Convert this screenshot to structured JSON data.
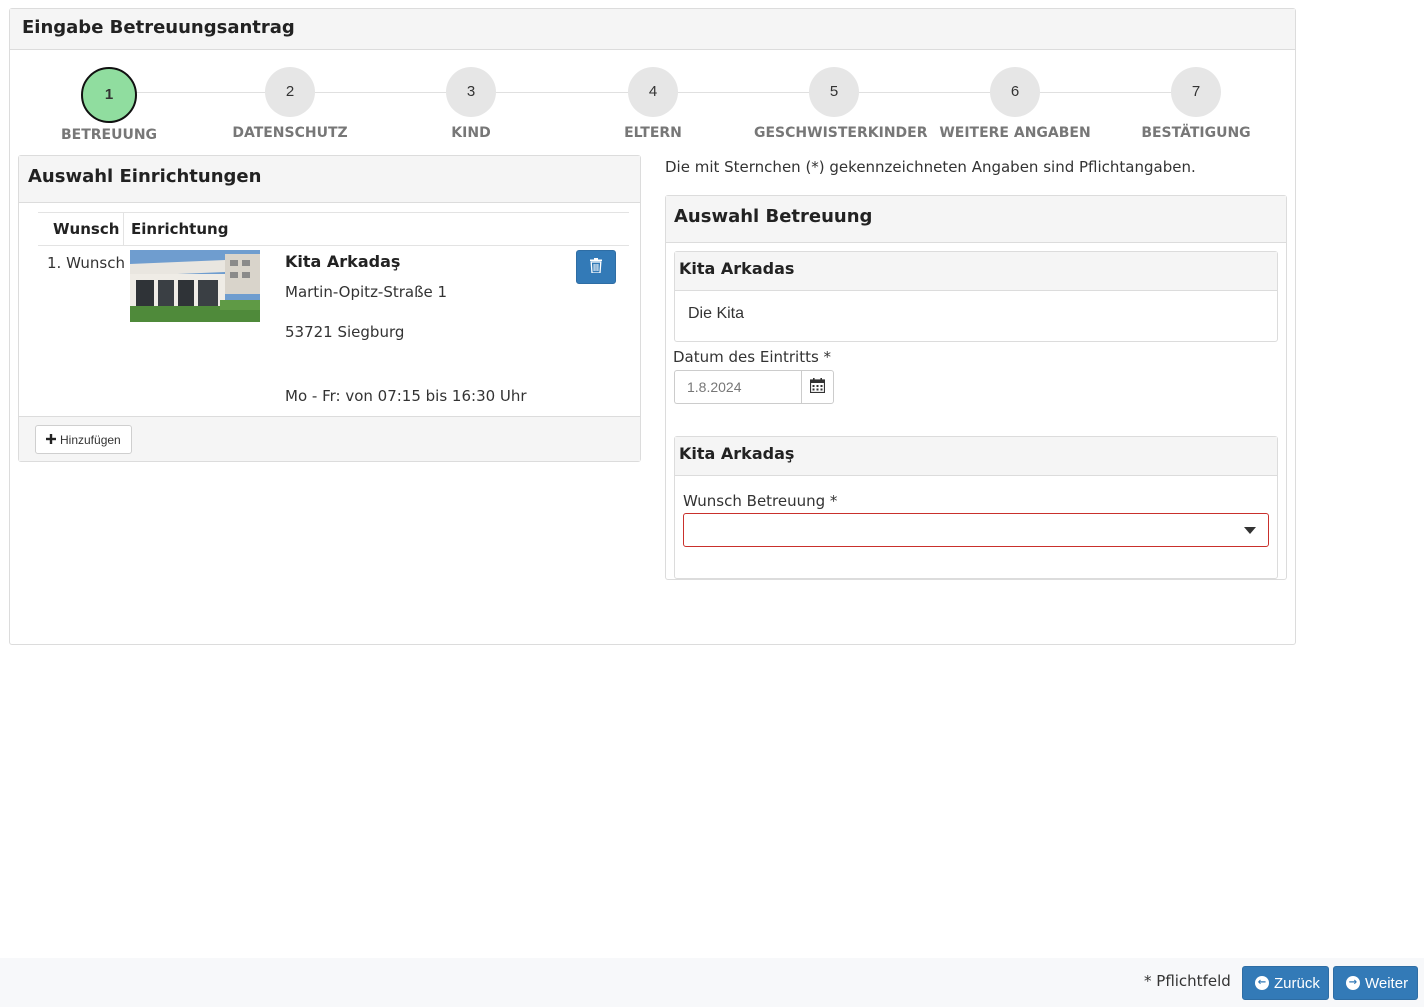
{
  "page": {
    "title": "Eingabe Betreuungsantrag"
  },
  "steps": [
    {
      "number": "1",
      "label": "BETREUUNG",
      "active": true
    },
    {
      "number": "2",
      "label": "DATENSCHUTZ"
    },
    {
      "number": "3",
      "label": "KIND"
    },
    {
      "number": "4",
      "label": "ELTERN"
    },
    {
      "number": "5",
      "label": "GESCHWISTERKINDER"
    },
    {
      "number": "6",
      "label": "WEITERE ANGABEN"
    },
    {
      "number": "7",
      "label": "BESTÄTIGUNG"
    }
  ],
  "facilities_panel": {
    "title": "Auswahl Einrichtungen",
    "columns": [
      "Wunsch",
      "Einrichtung"
    ],
    "rows": [
      {
        "rank": "1. Wunsch",
        "name": "Kita Arkadaş",
        "street": "Martin-Opitz-Straße 1",
        "city": "53721 Siegburg",
        "hours": "Mo - Fr: von 07:15 bis 16:30 Uhr",
        "delete_icon": "trash-icon"
      }
    ],
    "add_label": "Hinzufügen",
    "add_icon": "plus-icon"
  },
  "required_note": "Die mit Sternchen (*) gekennzeichneten Angaben sind Pflichtangaben.",
  "care_panel": {
    "title": "Auswahl Betreuung",
    "facility_box": {
      "title": "Kita Arkadas",
      "description": "Die Kita"
    },
    "entry_date": {
      "label": "Datum des Eintritts *",
      "value": "1.8.2024",
      "icon": "calendar-icon"
    },
    "care_box": {
      "title": "Kita Arkadaş",
      "select_label": "Wunsch Betreuung *",
      "select_value": ""
    }
  },
  "footer": {
    "required_note": "* Pflichtfeld",
    "back_label": "Zurück",
    "next_label": "Weiter"
  },
  "colors": {
    "primary": "#337ab7",
    "active_step": "#90dd9f",
    "error_border": "#c9302c"
  }
}
